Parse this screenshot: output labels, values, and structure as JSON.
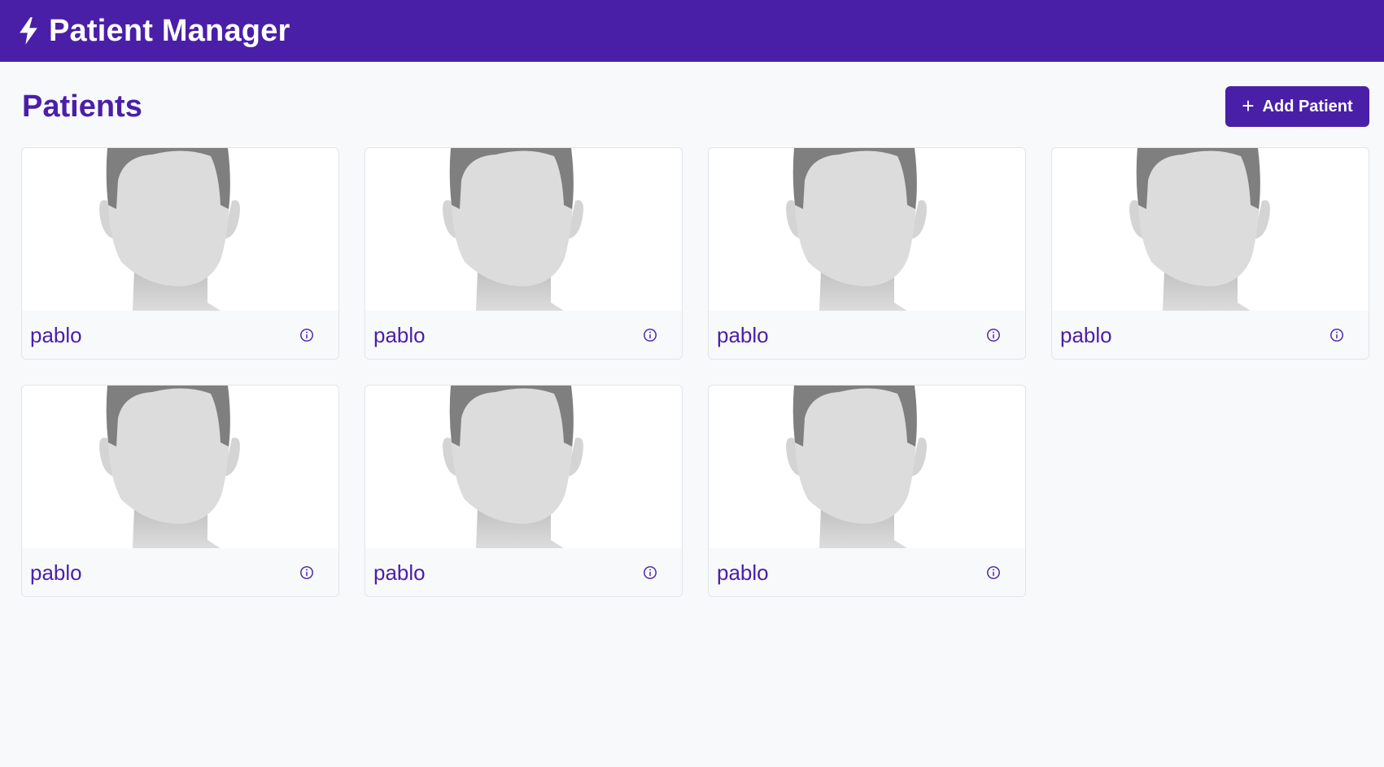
{
  "navbar": {
    "title": "Patient Manager",
    "icon": "bolt-icon"
  },
  "page": {
    "title": "Patients",
    "add_button_label": "Add Patient"
  },
  "patients": [
    {
      "name": "pablo"
    },
    {
      "name": "pablo"
    },
    {
      "name": "pablo"
    },
    {
      "name": "pablo"
    },
    {
      "name": "pablo"
    },
    {
      "name": "pablo"
    },
    {
      "name": "pablo"
    }
  ],
  "colors": {
    "primary": "#4a1fa8",
    "background": "#f8f9fb"
  }
}
